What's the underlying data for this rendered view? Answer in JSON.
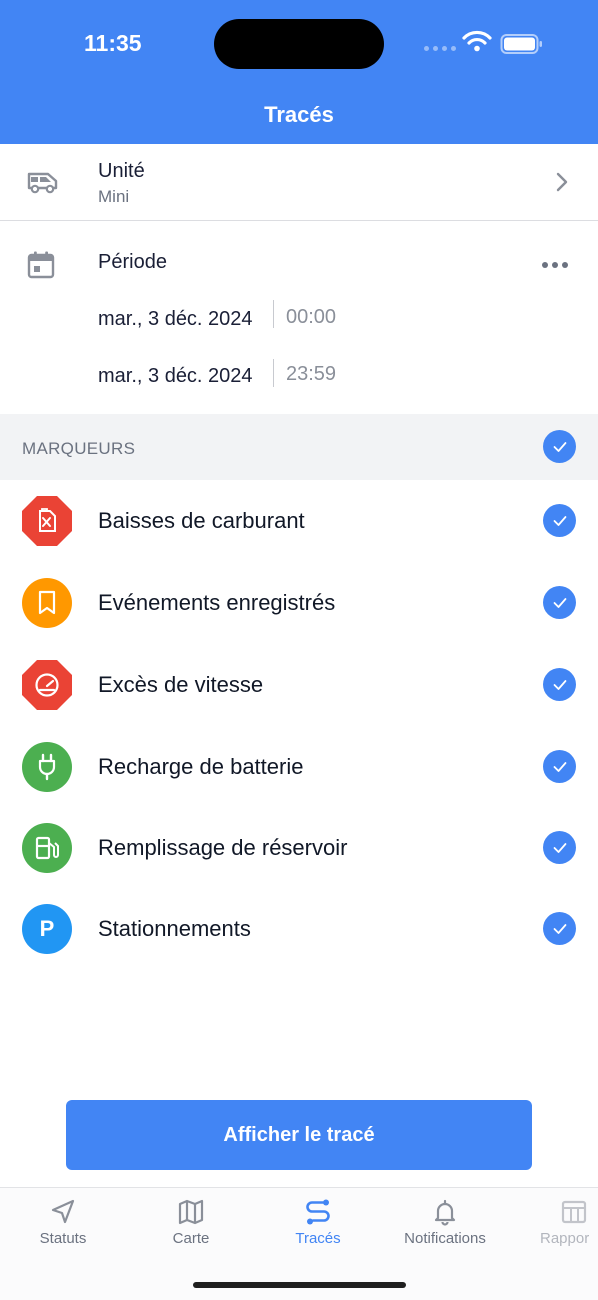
{
  "status_bar": {
    "time": "11:35"
  },
  "nav": {
    "title": "Tracés"
  },
  "unit": {
    "label": "Unité",
    "value": "Mini",
    "icon": "van-icon"
  },
  "period": {
    "label": "Période",
    "icon": "calendar-icon",
    "start_date": "mar., 3 déc. 2024",
    "start_time": "00:00",
    "end_date": "mar., 3 déc. 2024",
    "end_time": "23:59"
  },
  "markers": {
    "header": "MARQUEURS",
    "all_checked": true,
    "items": [
      {
        "label": "Baisses de carburant",
        "icon": "fuel-can-icon",
        "color": "#ea4335",
        "checked": true
      },
      {
        "label": "Evénements enregistrés",
        "icon": "bookmark-icon",
        "color": "#ff9800",
        "checked": true
      },
      {
        "label": "Excès de vitesse",
        "icon": "speedometer-icon",
        "color": "#ea4335",
        "checked": true
      },
      {
        "label": "Recharge de batterie",
        "icon": "plug-icon",
        "color": "#4caf50",
        "checked": true
      },
      {
        "label": "Remplissage de réservoir",
        "icon": "fuel-pump-icon",
        "color": "#4caf50",
        "checked": true
      },
      {
        "label": "Stationnements",
        "icon": "parking-icon",
        "color": "#2196f3",
        "checked": true
      }
    ]
  },
  "action": {
    "label": "Afficher le tracé"
  },
  "tabs": [
    {
      "label": "Statuts",
      "icon": "navigation-arrow-icon",
      "active": false
    },
    {
      "label": "Carte",
      "icon": "map-icon",
      "active": false
    },
    {
      "label": "Tracés",
      "icon": "route-icon",
      "active": true
    },
    {
      "label": "Notifications",
      "icon": "bell-icon",
      "active": false
    },
    {
      "label": "Rappor",
      "icon": "table-icon",
      "active": false
    }
  ],
  "colors": {
    "accent": "#4285f4",
    "danger": "#ea4335",
    "warning": "#ff9800",
    "success": "#4caf50",
    "info": "#2196f3"
  }
}
